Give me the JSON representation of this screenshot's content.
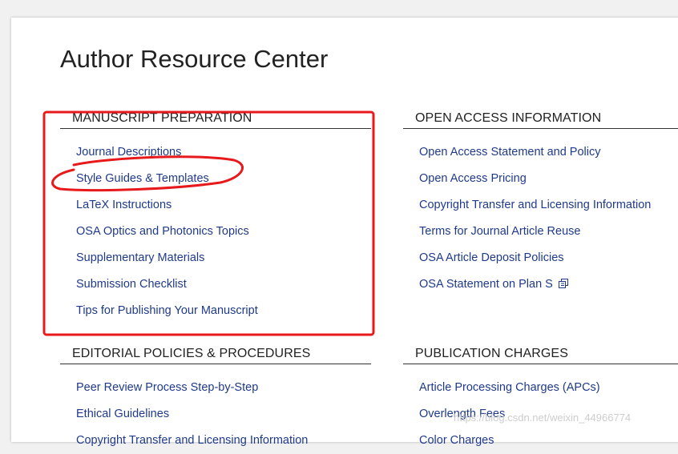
{
  "page": {
    "title": "Author Resource Center"
  },
  "sections": {
    "manuscript": {
      "heading": "MANUSCRIPT PREPARATION",
      "links": [
        "Journal Descriptions",
        "Style Guides & Templates",
        "LaTeX Instructions",
        "OSA Optics and Photonics Topics",
        "Supplementary Materials",
        "Submission Checklist",
        "Tips for Publishing Your Manuscript"
      ]
    },
    "open_access": {
      "heading": "OPEN ACCESS INFORMATION",
      "links": [
        "Open Access Statement and Policy",
        "Open Access Pricing",
        "Copyright Transfer and Licensing Information",
        "Terms for Journal Article Reuse",
        "OSA Article Deposit Policies",
        "OSA Statement on Plan S"
      ]
    },
    "editorial": {
      "heading": "EDITORIAL POLICIES & PROCEDURES",
      "links": [
        "Peer Review Process Step-by-Step",
        "Ethical Guidelines",
        "Copyright Transfer and Licensing Information"
      ]
    },
    "charges": {
      "heading": "PUBLICATION CHARGES",
      "links": [
        "Article Processing Charges (APCs)",
        "Overlength Fees",
        "Color Charges"
      ]
    }
  },
  "icons": {
    "external_link": "external-link-icon"
  },
  "annotation": {
    "color": "#e8191b"
  },
  "watermark": "https://blog.csdn.net/weixin_44966774",
  "colors": {
    "link": "#1f3a8a",
    "heading": "#222222",
    "background": "#f1f1f1",
    "panel": "#ffffff"
  }
}
